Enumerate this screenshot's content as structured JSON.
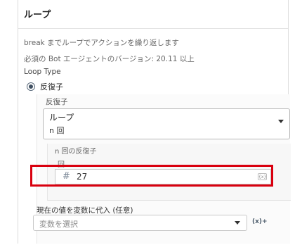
{
  "header": {
    "title": "ループ"
  },
  "description": {
    "line1": "break までループでアクションを繰り返します",
    "line2": "必須の Bot エージェントのバージョン: 20.11 以上"
  },
  "loop_type": {
    "label": "Loop Type",
    "selected_option": "反復子",
    "selected": true
  },
  "iterator": {
    "label": "反復子",
    "select": {
      "main": "ループ",
      "sub": "n 回"
    }
  },
  "n_times": {
    "section_label": "n 回の反復子",
    "field_label": "回",
    "value": "27",
    "fx_label": "{x}"
  },
  "assign": {
    "label": "現在の値を変数に代入 (任意)",
    "placeholder": "変数を選択",
    "fx_label": "(x)+"
  }
}
